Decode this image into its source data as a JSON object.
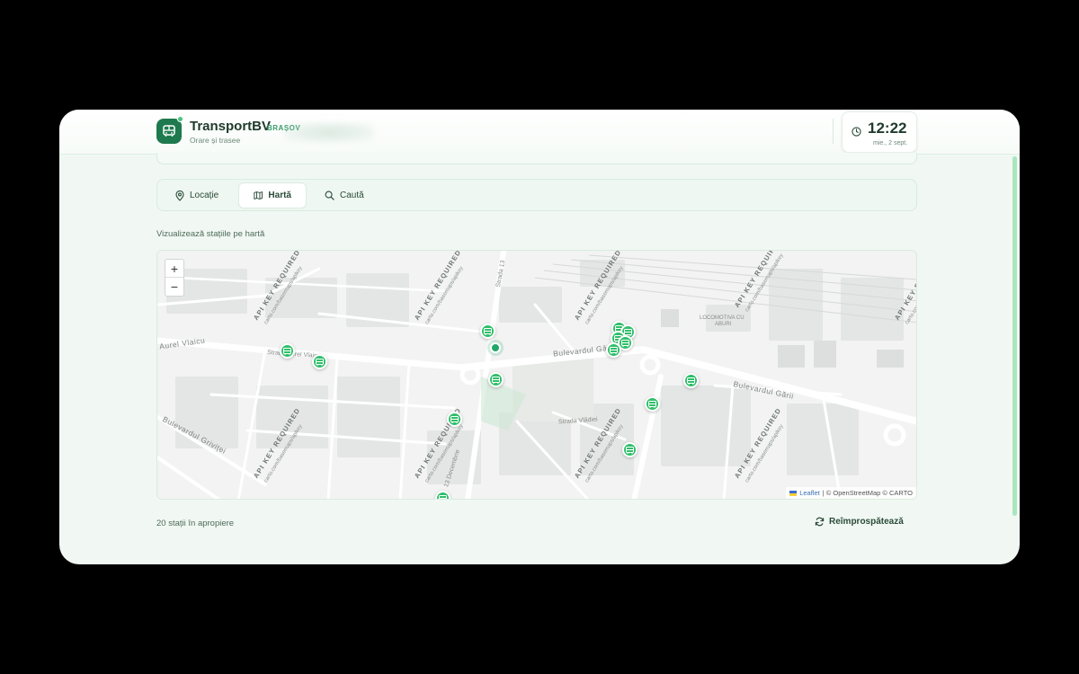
{
  "header": {
    "app_name": "TransportBV",
    "city": "BRAȘOV",
    "subtitle": "Orare și trasee",
    "time": "12:22",
    "date": "mie., 2 sept."
  },
  "tabs": [
    {
      "label": "Locație",
      "icon": "map-pin-icon",
      "active": false
    },
    {
      "label": "Hartă",
      "icon": "map-icon",
      "active": true
    },
    {
      "label": "Caută",
      "icon": "search-icon",
      "active": false
    }
  ],
  "map_section": {
    "label": "Vizualizează stațiile pe hartă",
    "zoom_in": "+",
    "zoom_out": "−",
    "attribution_leaflet": "Leaflet",
    "attribution_rest": "| © OpenStreetMap © CARTO",
    "watermark": "API KEY REQUIRED",
    "watermark_sub": "carto.com/basemaps/apikey",
    "streets": {
      "aurel_vlaicu": "Aurel Vlaicu",
      "strada_aurel_vlaicu": "Strada Aurel Vlaicu",
      "bulevardul_garii_1": "Bulevardul Gării",
      "bulevardul_garii_2": "Bulevardul Gării",
      "strada_13": "Strada 13",
      "grivitei": "Bulevardul Griviței",
      "locomotiva": "LOCOMOTIVA CU",
      "aburi": "ABURI",
      "vladiei": "Strada Vlădiei",
      "decembrie": "13 Decembrie"
    }
  },
  "footer": {
    "stations_count": "20 stații în apropiere",
    "refresh_label": "Reîmprospătează"
  },
  "colors": {
    "accent": "#1e7a4e",
    "marker": "#2fbf6a",
    "background": "#f1f8f3"
  }
}
